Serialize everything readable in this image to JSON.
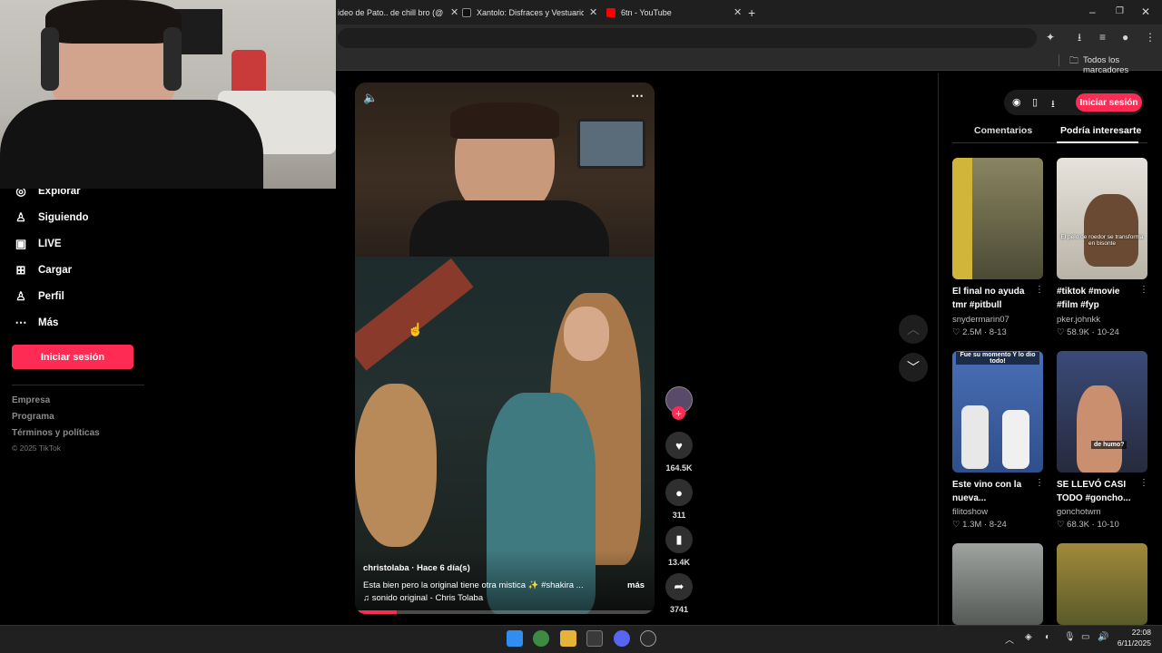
{
  "browser": {
    "tabs": [
      {
        "title": "ideo de Pato.. de chill bro (@",
        "icon_color": "#ffffff"
      },
      {
        "title": "Xantolo: Disfraces y Vestuario p",
        "icon": "tiktok-icon",
        "icon_color": "#ffffff"
      },
      {
        "title": "6tn - YouTube",
        "icon": "youtube-icon",
        "icon_color": "#ff0000"
      }
    ],
    "bookmarks_label": "Todos los marcadores"
  },
  "sidebar": {
    "items": [
      {
        "label": "Explorar",
        "icon": "compass-icon"
      },
      {
        "label": "Siguiendo",
        "icon": "following-icon"
      },
      {
        "label": "LIVE",
        "icon": "live-icon"
      },
      {
        "label": "Cargar",
        "icon": "upload-icon"
      },
      {
        "label": "Perfil",
        "icon": "profile-icon"
      },
      {
        "label": "Más",
        "icon": "more-icon"
      }
    ],
    "login_label": "Iniciar sesión",
    "footer": [
      "Empresa",
      "Programa",
      "Términos y políticas",
      "© 2025 TikTok"
    ]
  },
  "video": {
    "author": "christolaba",
    "time": "Hace 6 día(s)",
    "author_line": "christolaba · Hace 6 día(s)",
    "caption": "Esta bien pero la original tiene otra mistica ✨ #shakira ...",
    "more_label": "más",
    "sound": "♫ sonido original - Chris Tolaba",
    "progress": 0.14,
    "likes": "164.5K",
    "comments": "311",
    "saves": "13.4K",
    "shares": "3741"
  },
  "right_panel": {
    "login_label": "Iniciar sesión",
    "tabs": [
      "Comentarios",
      "Podría interesarte"
    ],
    "active_tab": "Podría interesarte",
    "cards": [
      {
        "title": "El final no ayuda tmr #pitbull",
        "user": "snydermarin07",
        "likes": "2.5M",
        "date": "8-13",
        "overlay": "",
        "thumb_color": "#6b6a4a"
      },
      {
        "title": "#tiktok #movie #film #fyp",
        "user": "pker.johnkk",
        "likes": "58.9K",
        "date": "10-24",
        "overlay": "El pelo de roedor se transforma en bisonte",
        "thumb_color": "#c9c4bb"
      },
      {
        "title": "Este vino con la nueva...",
        "user": "filitoshow",
        "likes": "1.3M",
        "date": "8-24",
        "overlay": "Fue su momento Y lo dio todo!",
        "thumb_color": "#3d5fa5"
      },
      {
        "title": "SE LLEVÓ CASI TODO #goncho...",
        "user": "gonchotwm",
        "likes": "68.3K",
        "date": "10-10",
        "overlay": "de humo?",
        "thumb_color": "#3a3f5a"
      },
      {
        "title": "",
        "user": "",
        "likes": "",
        "date": "",
        "overlay": "",
        "thumb_color": "#8a8e8c"
      },
      {
        "title": "",
        "user": "",
        "likes": "",
        "date": "",
        "overlay": "",
        "thumb_color": "#8a7a3a"
      }
    ]
  },
  "taskbar": {
    "time": "22:08",
    "date": "6/11/2025"
  }
}
